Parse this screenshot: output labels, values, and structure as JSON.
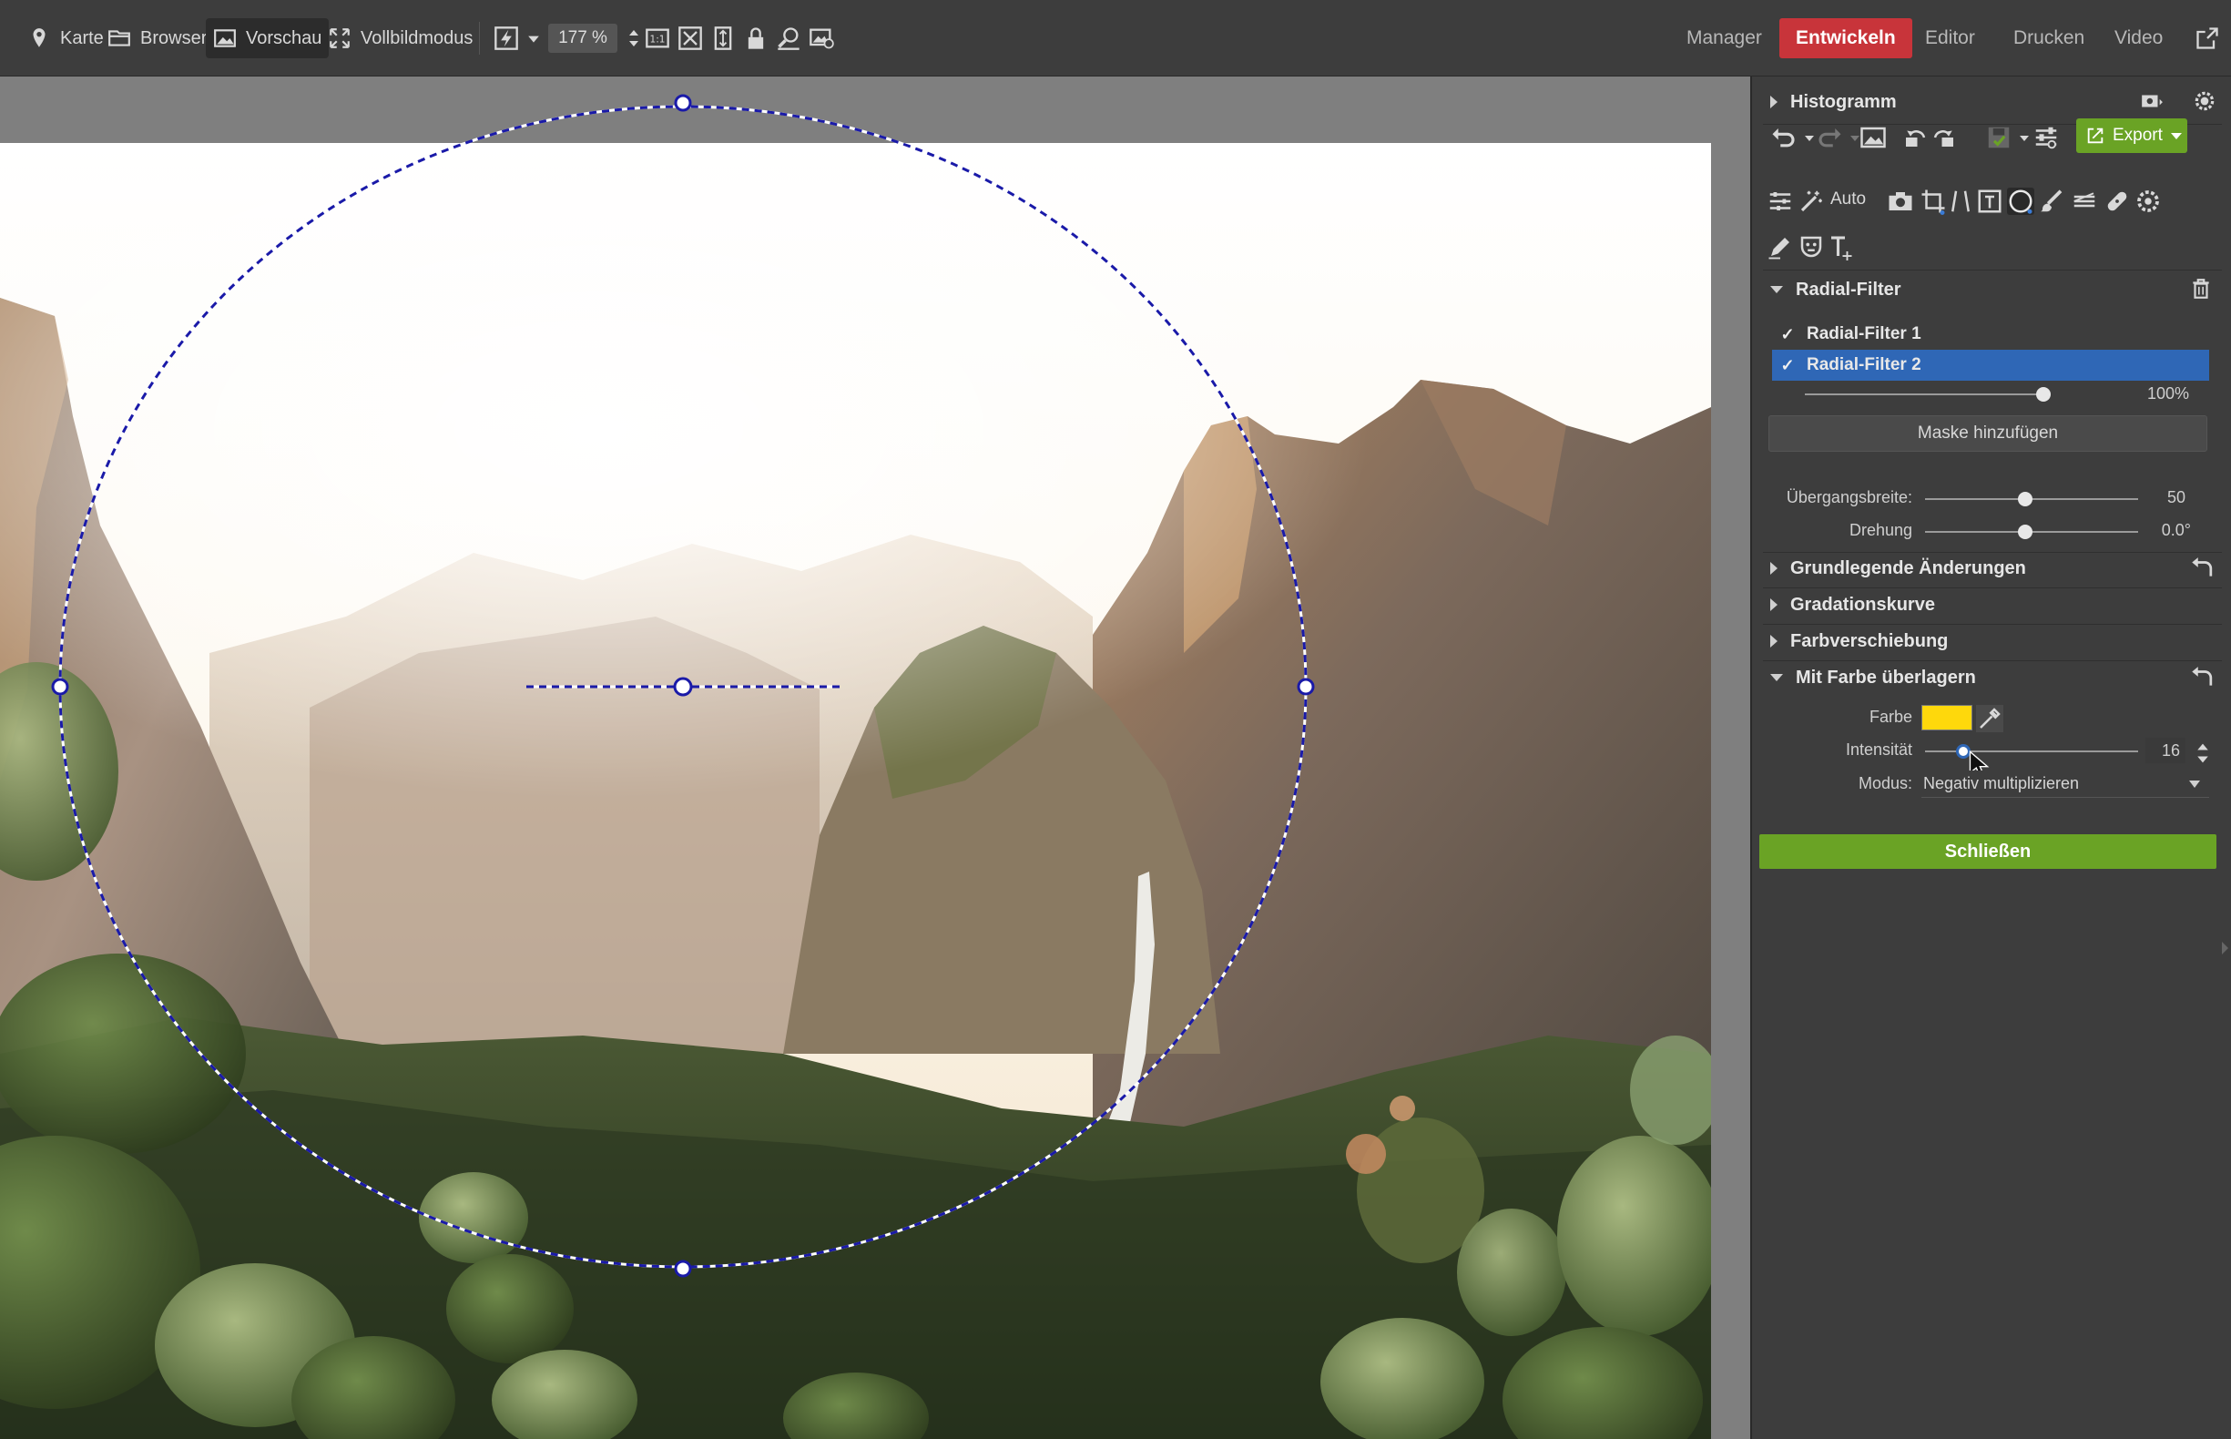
{
  "toolbar": {
    "map_label": "Karte",
    "browser_label": "Browser",
    "preview_label": "Vorschau",
    "fullscreen_label": "Vollbildmodus",
    "zoom_value": "177 %"
  },
  "modes": {
    "manager": "Manager",
    "develop": "Entwickeln",
    "editor": "Editor",
    "print": "Drucken",
    "video": "Video"
  },
  "panel": {
    "histogram_title": "Histogramm",
    "export_label": "Export",
    "auto_label": "Auto",
    "radial_filter": {
      "title": "Radial-Filter",
      "items": [
        {
          "label": "Radial-Filter 1",
          "checked": "✓"
        },
        {
          "label": "Radial-Filter 2",
          "checked": "✓"
        }
      ],
      "opacity_value": "100%",
      "opacity_fraction": 1.0,
      "add_mask_label": "Maske hinzufügen",
      "transition_label": "Übergangsbreite:",
      "transition_value": "50",
      "rotation_label": "Drehung",
      "rotation_value": "0.0°"
    },
    "sections": {
      "basic": "Grundlegende Änderungen",
      "curves": "Gradationskurve",
      "color_shift": "Farbverschiebung",
      "overlay": "Mit Farbe überlagern"
    },
    "overlay": {
      "color_label": "Farbe",
      "color_value": "#fed80c",
      "intensity_label": "Intensität",
      "intensity_value": "16",
      "mode_label": "Modus:",
      "mode_value": "Negativ multiplizieren"
    },
    "close_label": "Schließen"
  },
  "colors": {
    "accent_red": "#c8343a",
    "accent_green": "#6aa325",
    "selection_blue": "#2f67b6",
    "mask_outline": "#1a1aa8"
  }
}
